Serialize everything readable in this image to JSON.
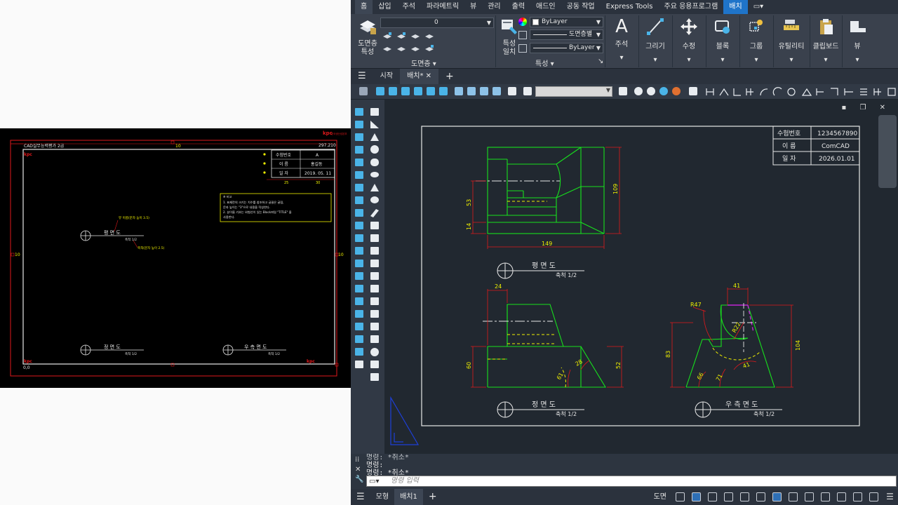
{
  "reference": {
    "header_title": "CAD실무능력평가 2급",
    "header_code": "297.210",
    "logo_text": "kpc",
    "logo_sub": "한국생산성본부",
    "dim_top": "10",
    "dim_left": "10",
    "dim_right": "10",
    "dim_bottom": "10",
    "origin_label": "0,0",
    "title_block": {
      "rows": [
        {
          "label": "수험번호",
          "value": "A"
        },
        {
          "label": "이 름",
          "value": "홍길동"
        },
        {
          "label": "일 자",
          "value": "2019. 05. 11"
        }
      ],
      "col_dims": [
        "25",
        "30"
      ]
    },
    "notes": {
      "heading": "※ 비고",
      "items": [
        "1.   표제란의 크기는 치수를 참조하고 글꼴은 굴림,",
        "      문자 높이는 \"3\"으로 내용을 작성한다.",
        "2.   뷰이름 기호는 외형선이 있는 Block파일 \"TITLE\" 을",
        "      사용한다."
      ]
    },
    "callouts": {
      "view_name_text": "뷰 이름(문자 높이 3.5)",
      "scale_text": "축척(문자 높이 2.5)"
    },
    "views": [
      {
        "name": "평 면 도",
        "scale": "축척 1/2"
      },
      {
        "name": "정 면 도",
        "scale": "축척 1/2"
      },
      {
        "name": "우 측 면 도",
        "scale": "축척 1/2"
      }
    ]
  },
  "ribbon": {
    "tabs": [
      "홈",
      "삽입",
      "주석",
      "파라메트릭",
      "뷰",
      "관리",
      "출력",
      "애드인",
      "공동 작업",
      "Express Tools",
      "주요 응용프로그램",
      "배치"
    ],
    "active_tab": "배치",
    "layer_panel": {
      "big_button": "도면층\n특성",
      "current_layer": "0",
      "panel_label": "도면층"
    },
    "properties_panel": {
      "big_button": "특성\n일치",
      "color": "ByLayer",
      "linetype": "도면층별",
      "lineweight": "ByLayer",
      "panel_label": "특성"
    },
    "big_buttons": [
      "주석",
      "그리기",
      "수정",
      "블록",
      "그룹",
      "유틸리티",
      "클립보드",
      "뷰"
    ]
  },
  "doc_tabs": {
    "start": "시작",
    "active": "배치*"
  },
  "drawing": {
    "title_block": {
      "rows": [
        {
          "label": "수험번호",
          "value": "1234567890"
        },
        {
          "label": "이 름",
          "value": "ComCAD"
        },
        {
          "label": "일 자",
          "value": "2026.01.01"
        }
      ]
    },
    "top_view": {
      "name": "평 면 도",
      "scale": "축척 1/2",
      "dims": {
        "width": "149",
        "height": "109",
        "left1": "53",
        "left2": "14"
      }
    },
    "front_view": {
      "name": "정 면 도",
      "scale": "축척 1/2",
      "dims": {
        "top": "24",
        "left": "60",
        "right": "52",
        "angle1": "61",
        "angle2": "28"
      }
    },
    "side_view": {
      "name": "우 측 면 도",
      "scale": "축척 1/2",
      "dims": {
        "top": "41",
        "radius1": "R47",
        "radius2": "R22",
        "left": "83",
        "right": "104",
        "angle1": "66",
        "angle2": "71",
        "angle3": "41"
      }
    }
  },
  "command": {
    "history_line1": "명령: *취소*",
    "history_line2": "명령:",
    "history_line3": "명령: *취소*",
    "placeholder": "명령 입력"
  },
  "status": {
    "model": "모형",
    "layout": "배치1",
    "paper": "도면"
  },
  "colors": {
    "green": "#17e01d",
    "red": "#e0181b",
    "yellow": "#f0f000",
    "white_line": "#e8e8e8",
    "active_tab": "#1f74c9"
  }
}
